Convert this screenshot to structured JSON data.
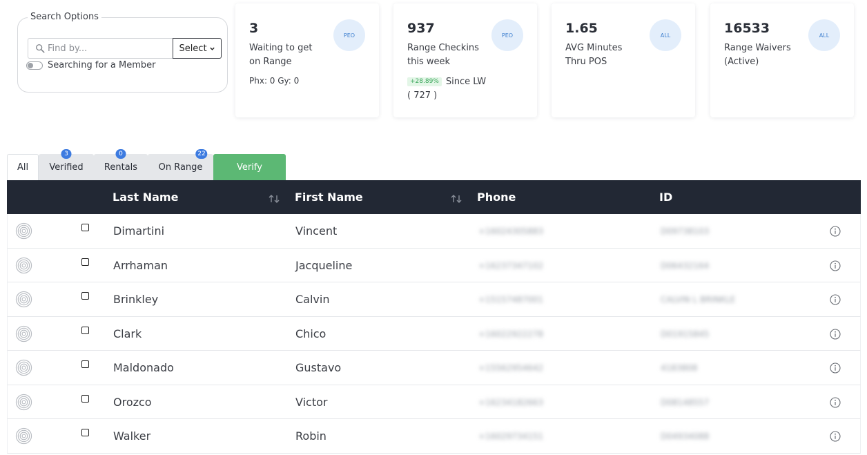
{
  "search": {
    "legend": "Search Options",
    "placeholder": "Find by...",
    "select_label": "Select",
    "member_toggle_label": "Searching for a Member"
  },
  "cards": [
    {
      "number": "3",
      "label": "Waiting to get on Range",
      "badge": "PEO",
      "sub": "Phx: 0 Gy: 0"
    },
    {
      "number": "937",
      "label": "Range Checkins this week",
      "badge": "PEO",
      "trend_pct": "+28.89%",
      "trend_text": "Since LW ( 727 )"
    },
    {
      "number": "1.65",
      "label": "AVG Minutes Thru POS",
      "badge": "ALL"
    },
    {
      "number": "16533",
      "label": "Range Waivers (Active)",
      "badge": "ALL"
    }
  ],
  "tabs": [
    {
      "label": "All",
      "count": null,
      "active": true
    },
    {
      "label": "Verified",
      "count": "3"
    },
    {
      "label": "Rentals",
      "count": "0"
    },
    {
      "label": "On Range",
      "count": "22"
    },
    {
      "label": "Verify",
      "count": null
    }
  ],
  "table": {
    "headers": {
      "last_name": "Last Name",
      "first_name": "First Name",
      "phone": "Phone",
      "id": "ID"
    },
    "rows": [
      {
        "last": "Dimartini",
        "first": "Vincent",
        "phone": "+16024305883",
        "id": "D09738103"
      },
      {
        "last": "Arrhaman",
        "first": "Jacqueline",
        "phone": "+16237347102",
        "id": "D06432164"
      },
      {
        "last": "Brinkley",
        "first": "Calvin",
        "phone": "+15157487001",
        "id": "CALVIN L BRINKLE"
      },
      {
        "last": "Clark",
        "first": "Chico",
        "phone": "+16022922278",
        "id": "D01915845"
      },
      {
        "last": "Maldonado",
        "first": "Gustavo",
        "phone": "+15562954642",
        "id": "4183808"
      },
      {
        "last": "Orozco",
        "first": "Victor",
        "phone": "+16234182663",
        "id": "D08148557"
      },
      {
        "last": "Walker",
        "first": "Robin",
        "phone": "+16029734151",
        "id": "D04934088"
      }
    ]
  },
  "colors": {
    "header_bg": "#222834",
    "verify_tab": "#5cb874",
    "count_badge": "#3d7be0",
    "card_badge_bg": "#e3eefb",
    "trend_green": "#3aa65a"
  }
}
